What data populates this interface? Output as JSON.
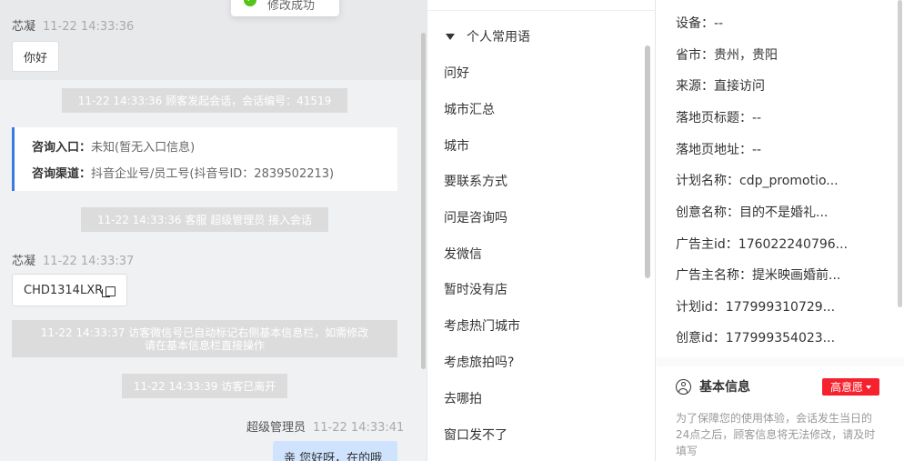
{
  "toast": {
    "text": "修改成功",
    "icon": "check-circle-icon"
  },
  "chat": {
    "messages": {
      "m1": {
        "sender": "芯凝",
        "time": "11-22 14:33:36",
        "text": "你好"
      },
      "sys1": "11-22 14:33:36 顾客发起会话，会话编号：41519",
      "source": {
        "entry_label": "咨询入口：",
        "entry_value": "未知(暂无入口信息)",
        "channel_label": "咨询渠道：",
        "channel_value": "抖音企业号/员工号(抖音号ID：2839502213)"
      },
      "sys2": "11-22 14:33:36 客服 超级管理员 接入会话",
      "m2": {
        "sender": "芯凝",
        "time": "11-22 14:33:37",
        "text": "CHD1314LXR"
      },
      "sys3_line1": "11-22 14:33:37 访客微信号已自动标记右侧基本信息栏，如需修改",
      "sys3_line2": "请在基本信息栏直接操作",
      "sys4": "11-22 14:33:39 访客已离开",
      "m3": {
        "sender": "超级管理员",
        "time": "11-22 14:33:41",
        "text": "亲 您好呀，在的哦"
      }
    }
  },
  "phrases": {
    "group": "个人常用语",
    "items": [
      "问好",
      "城市汇总",
      "城市",
      "要联系方式",
      "问是咨询吗",
      "发微信",
      "暂时没有店",
      "考虑热门城市",
      "考虑旅拍吗?",
      "去哪拍",
      "窗口发不了"
    ]
  },
  "info": {
    "fields": [
      {
        "label": "设备：",
        "value": "--"
      },
      {
        "label": "省市：",
        "value": "贵州，贵阳"
      },
      {
        "label": "来源：",
        "value": "直接访问"
      },
      {
        "label": "落地页标题：",
        "value": "--"
      },
      {
        "label": "落地页地址：",
        "value": "--"
      },
      {
        "label": "计划名称：",
        "value": "cdp_promotio..."
      },
      {
        "label": "创意名称：",
        "value": "目的不是婚礼..."
      },
      {
        "label": "广告主id：",
        "value": "176022240796..."
      },
      {
        "label": "广告主名称：",
        "value": "提米映画婚前..."
      },
      {
        "label": "计划id：",
        "value": "177999310729..."
      },
      {
        "label": "创意id：",
        "value": "177999354023..."
      }
    ],
    "basic": {
      "title": "基本信息",
      "badge": "高意愿",
      "hint": "为了保障您的使用体验，会话发生当日的24点之后，顾客信息将无法修改，请及时填写"
    }
  }
}
